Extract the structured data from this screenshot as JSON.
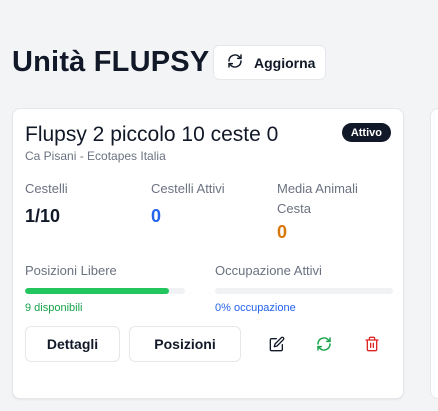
{
  "header": {
    "title": "Unità FLUPSY",
    "refresh_label": "Aggiorna"
  },
  "card": {
    "title": "Flupsy 2 piccolo 10 ceste  0",
    "subtitle": "Ca Pisani - Ecotapes Italia",
    "status": "Attivo",
    "stats": [
      {
        "label": "Cestelli",
        "value": "1/10"
      },
      {
        "label": "Cestelli Attivi",
        "value": "0"
      },
      {
        "label": "Media Animali Cesta",
        "value": "0"
      }
    ],
    "free_positions": {
      "label": "Posizioni Libere",
      "caption": "9 disponibili",
      "fraction": 0.9
    },
    "active_occupancy": {
      "label": "Occupazione Attivi",
      "caption": "0% occupazione",
      "fraction": 0
    },
    "details_label": "Dettagli",
    "positions_label": "Posizioni"
  },
  "colors": {
    "blue": "#2563eb",
    "orange": "#d97706",
    "green": "#22c55e",
    "green_text": "#16a34a",
    "red": "#dc2626",
    "badge_bg": "#111827"
  },
  "icons": {
    "refresh": "refresh-icon",
    "edit": "edit-icon",
    "sync": "refresh-icon",
    "delete": "trash-icon"
  }
}
